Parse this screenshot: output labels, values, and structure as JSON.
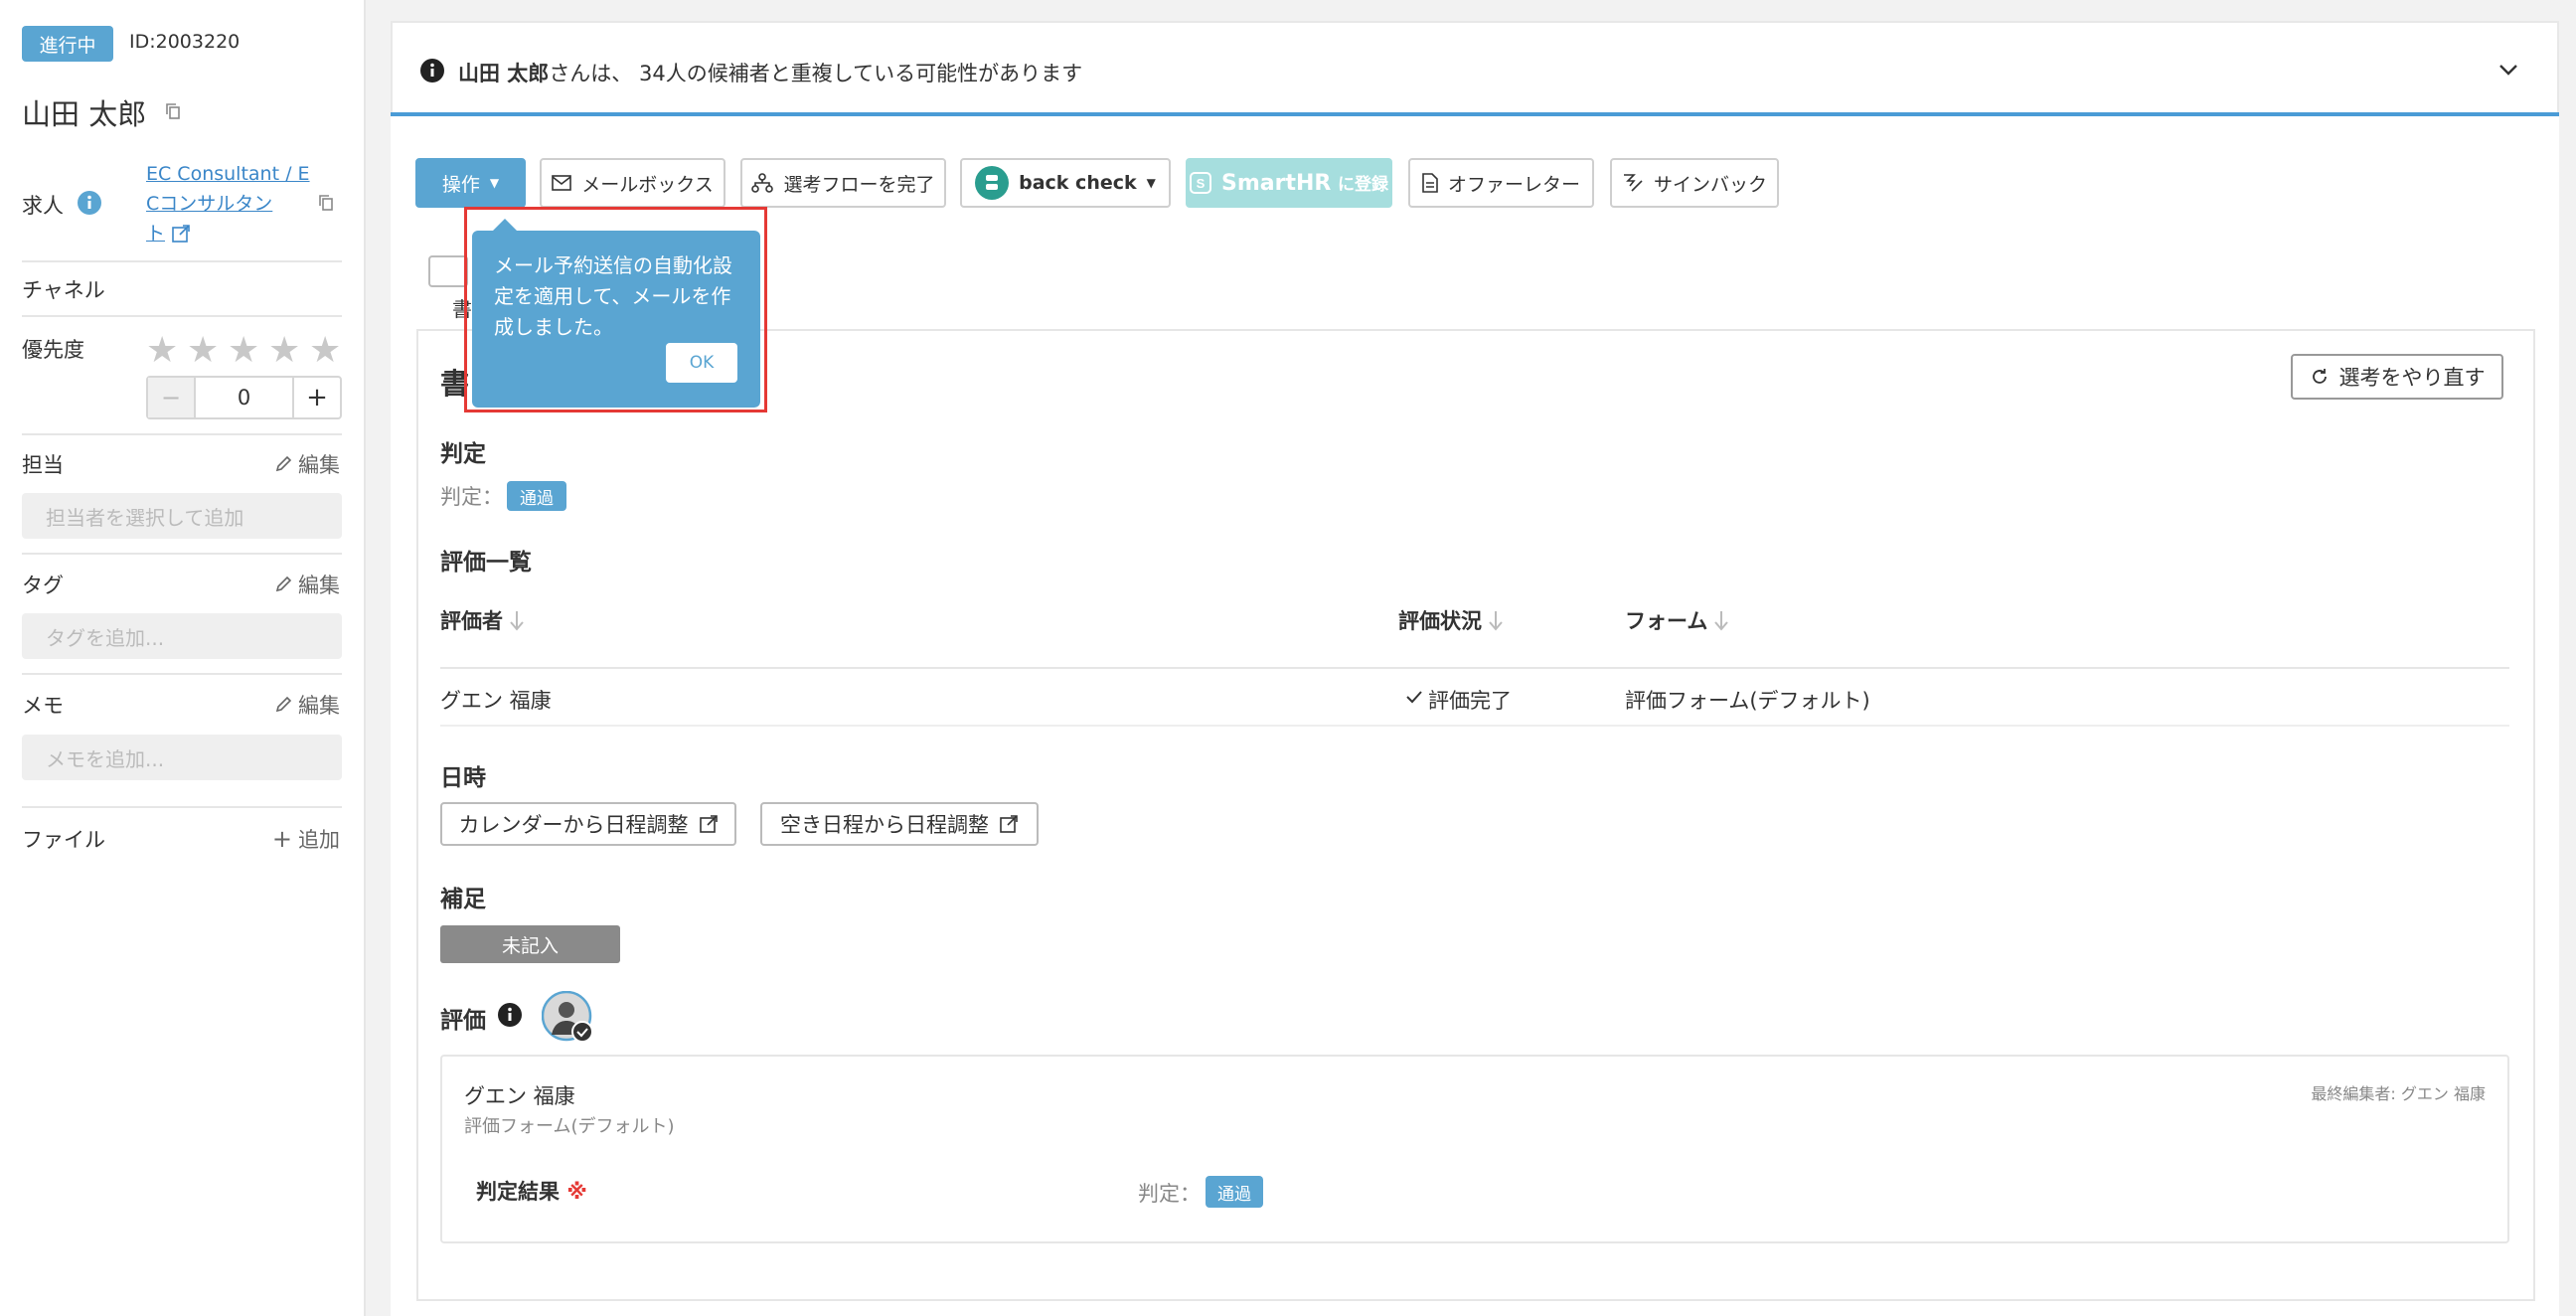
{
  "sidebar": {
    "status_badge": "進行中",
    "id_text": "ID:2003220",
    "candidate_name": "山田 太郎",
    "job_label": "求人",
    "job_link_line1": "EC Consultant / E",
    "job_link_line2": "Cコンサルタン",
    "job_link_line3": "ト",
    "channel_label": "チャネル",
    "priority_label": "優先度",
    "priority_stars_filled": 0,
    "priority_stars_total": 5,
    "priority_value": "0",
    "stepper_minus": "−",
    "stepper_plus": "+",
    "assignee_label": "担当",
    "assignee_edit": "編集",
    "assignee_placeholder": "担当者を選択して追加",
    "tag_label": "タグ",
    "tag_edit": "編集",
    "tag_placeholder": "タグを追加...",
    "memo_label": "メモ",
    "memo_edit": "編集",
    "memo_placeholder": "メモを追加...",
    "file_label": "ファイル",
    "file_add": "追加"
  },
  "banner": {
    "name_bold": "山田 太郎",
    "message": "さんは、 34人の候補者と重複している可能性があります"
  },
  "toolbar": {
    "operation": "操作",
    "mailbox": "メールボックス",
    "complete_flow": "選考フローを完了",
    "back_check": "back check",
    "smarthr": "SmartHR",
    "smarthr_suffix": "に登録",
    "offer_letter": "オファーレター",
    "sign_back": "サインバック"
  },
  "popover": {
    "message": "メール予約送信の自動化設定を適用して、メールを作成しました。",
    "ok": "OK"
  },
  "content": {
    "tab_partial": "書",
    "section_title_partial": "書",
    "redo_button": "選考をやり直す",
    "judgement_heading": "判定",
    "judgement_label": "判定：",
    "judgement_badge": "通過",
    "eval_list_heading": "評価一覧",
    "columns": [
      "評価者",
      "評価状況",
      "フォーム"
    ],
    "rows": [
      {
        "evaluator": "グエン 福康",
        "status": "評価完了",
        "form": "評価フォーム(デフォルト)"
      }
    ],
    "datetime_heading": "日時",
    "calendar_button": "カレンダーから日程調整",
    "free_slot_button": "空き日程から日程調整",
    "supplement_heading": "補足",
    "supplement_badge": "未記入",
    "evaluation_heading": "評価",
    "card": {
      "evaluator": "グエン 福康",
      "form": "評価フォーム(デフォルト)",
      "last_editor": "最終編集者: グエン 福康",
      "result_label": "判定結果",
      "required_mark": "※",
      "judgement_label": "判定：",
      "judgement_badge": "通過"
    }
  },
  "colors": {
    "accent": "#5aa5d2",
    "banner_line": "#4a9bd6",
    "popover_border": "#e53935",
    "smarthr": "#a6dede",
    "required": "#e53935"
  }
}
